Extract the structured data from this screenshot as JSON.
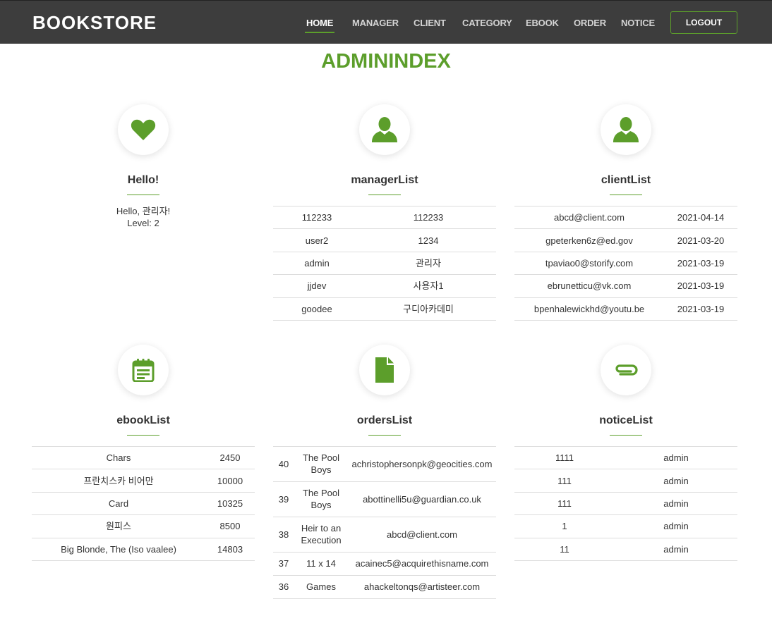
{
  "nav": {
    "brand": "BOOKSTORE",
    "items": [
      "HOME",
      "MANAGER",
      "CLIENT",
      "CATEGORY",
      "EBOOK",
      "ORDER",
      "NOTICE"
    ],
    "active": "HOME",
    "logout": "LOGOUT"
  },
  "page": {
    "title": "ADMININDEX"
  },
  "accent_color": "#5c9e2b",
  "hello": {
    "icon": "heart-icon",
    "title": "Hello!",
    "line1": "Hello, 관리자!",
    "line2": "Level: 2"
  },
  "managerList": {
    "icon": "user-icon",
    "title": "managerList",
    "rows": [
      [
        "112233",
        "112233"
      ],
      [
        "user2",
        "1234"
      ],
      [
        "admin",
        "관리자"
      ],
      [
        "jjdev",
        "사용자1"
      ],
      [
        "goodee",
        "구디아카데미"
      ]
    ]
  },
  "clientList": {
    "icon": "user-icon",
    "title": "clientList",
    "rows": [
      [
        "abcd@client.com",
        "2021-04-14"
      ],
      [
        "gpeterken6z@ed.gov",
        "2021-03-20"
      ],
      [
        "tpaviao0@storify.com",
        "2021-03-19"
      ],
      [
        "ebrunetticu@vk.com",
        "2021-03-19"
      ],
      [
        "bpenhalewickhd@youtu.be",
        "2021-03-19"
      ]
    ]
  },
  "ebookList": {
    "icon": "calendar-list-icon",
    "title": "ebookList",
    "rows": [
      [
        "Chars",
        "2450"
      ],
      [
        "프란치스카 비어만",
        "10000"
      ],
      [
        "Card",
        "10325"
      ],
      [
        "원피스",
        "8500"
      ],
      [
        "Big Blonde, The (Iso vaalee)",
        "14803"
      ]
    ]
  },
  "ordersList": {
    "icon": "document-icon",
    "title": "ordersList",
    "rows": [
      [
        "40",
        "The Pool Boys",
        "achristophersonpk@geocities.com"
      ],
      [
        "39",
        "The Pool Boys",
        "abottinelli5u@guardian.co.uk"
      ],
      [
        "38",
        "Heir to an Execution",
        "abcd@client.com"
      ],
      [
        "37",
        "11 x 14",
        "acainec5@acquirethisname.com"
      ],
      [
        "36",
        "Games",
        "ahackeltonqs@artisteer.com"
      ]
    ]
  },
  "noticeList": {
    "icon": "paperclip-icon",
    "title": "noticeList",
    "rows": [
      [
        "1111",
        "admin"
      ],
      [
        "111",
        "admin"
      ],
      [
        "111",
        "admin"
      ],
      [
        "1",
        "admin"
      ],
      [
        "11",
        "admin"
      ]
    ]
  }
}
